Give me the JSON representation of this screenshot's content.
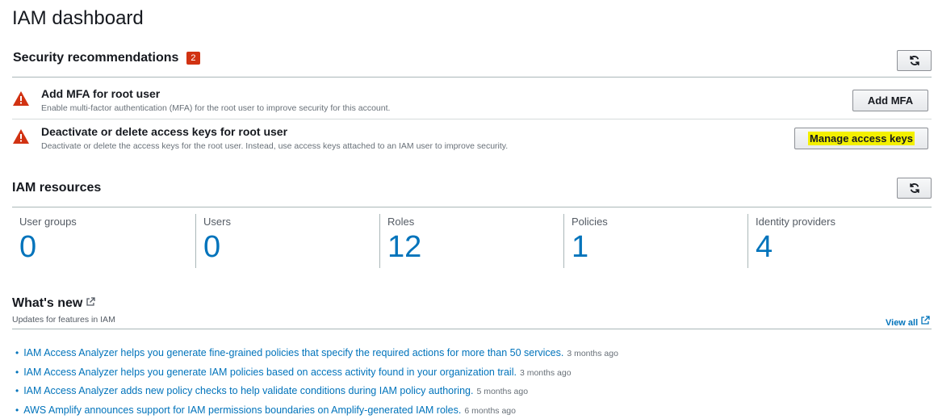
{
  "page": {
    "title": "IAM dashboard"
  },
  "security": {
    "title": "Security recommendations",
    "badge": "2",
    "items": [
      {
        "title": "Add MFA for root user",
        "description": "Enable multi-factor authentication (MFA) for the root user to improve security for this account.",
        "button": "Add MFA",
        "icon": "warning-icon"
      },
      {
        "title": "Deactivate or delete access keys for root user",
        "description": "Deactivate or delete the access keys for the root user. Instead, use access keys attached to an IAM user to improve security.",
        "button": "Manage access keys",
        "icon": "warning-icon"
      }
    ]
  },
  "resources": {
    "title": "IAM resources",
    "items": [
      {
        "label": "User groups",
        "value": "0"
      },
      {
        "label": "Users",
        "value": "0"
      },
      {
        "label": "Roles",
        "value": "12"
      },
      {
        "label": "Policies",
        "value": "1"
      },
      {
        "label": "Identity providers",
        "value": "4"
      }
    ]
  },
  "whats_new": {
    "title": "What's new",
    "subtitle": "Updates for features in IAM",
    "view_all": "View all",
    "items": [
      {
        "text": "IAM Access Analyzer helps you generate fine-grained policies that specify the required actions for more than 50 services.",
        "time": "3 months ago"
      },
      {
        "text": "IAM Access Analyzer helps you generate IAM policies based on access activity found in your organization trail.",
        "time": "3 months ago"
      },
      {
        "text": "IAM Access Analyzer adds new policy checks to help validate conditions during IAM policy authoring.",
        "time": "5 months ago"
      },
      {
        "text": "AWS Amplify announces support for IAM permissions boundaries on Amplify-generated IAM roles.",
        "time": "6 months ago"
      }
    ]
  },
  "colors": {
    "link": "#0073bb",
    "warning": "#d13212",
    "highlight": "#f3f000"
  }
}
